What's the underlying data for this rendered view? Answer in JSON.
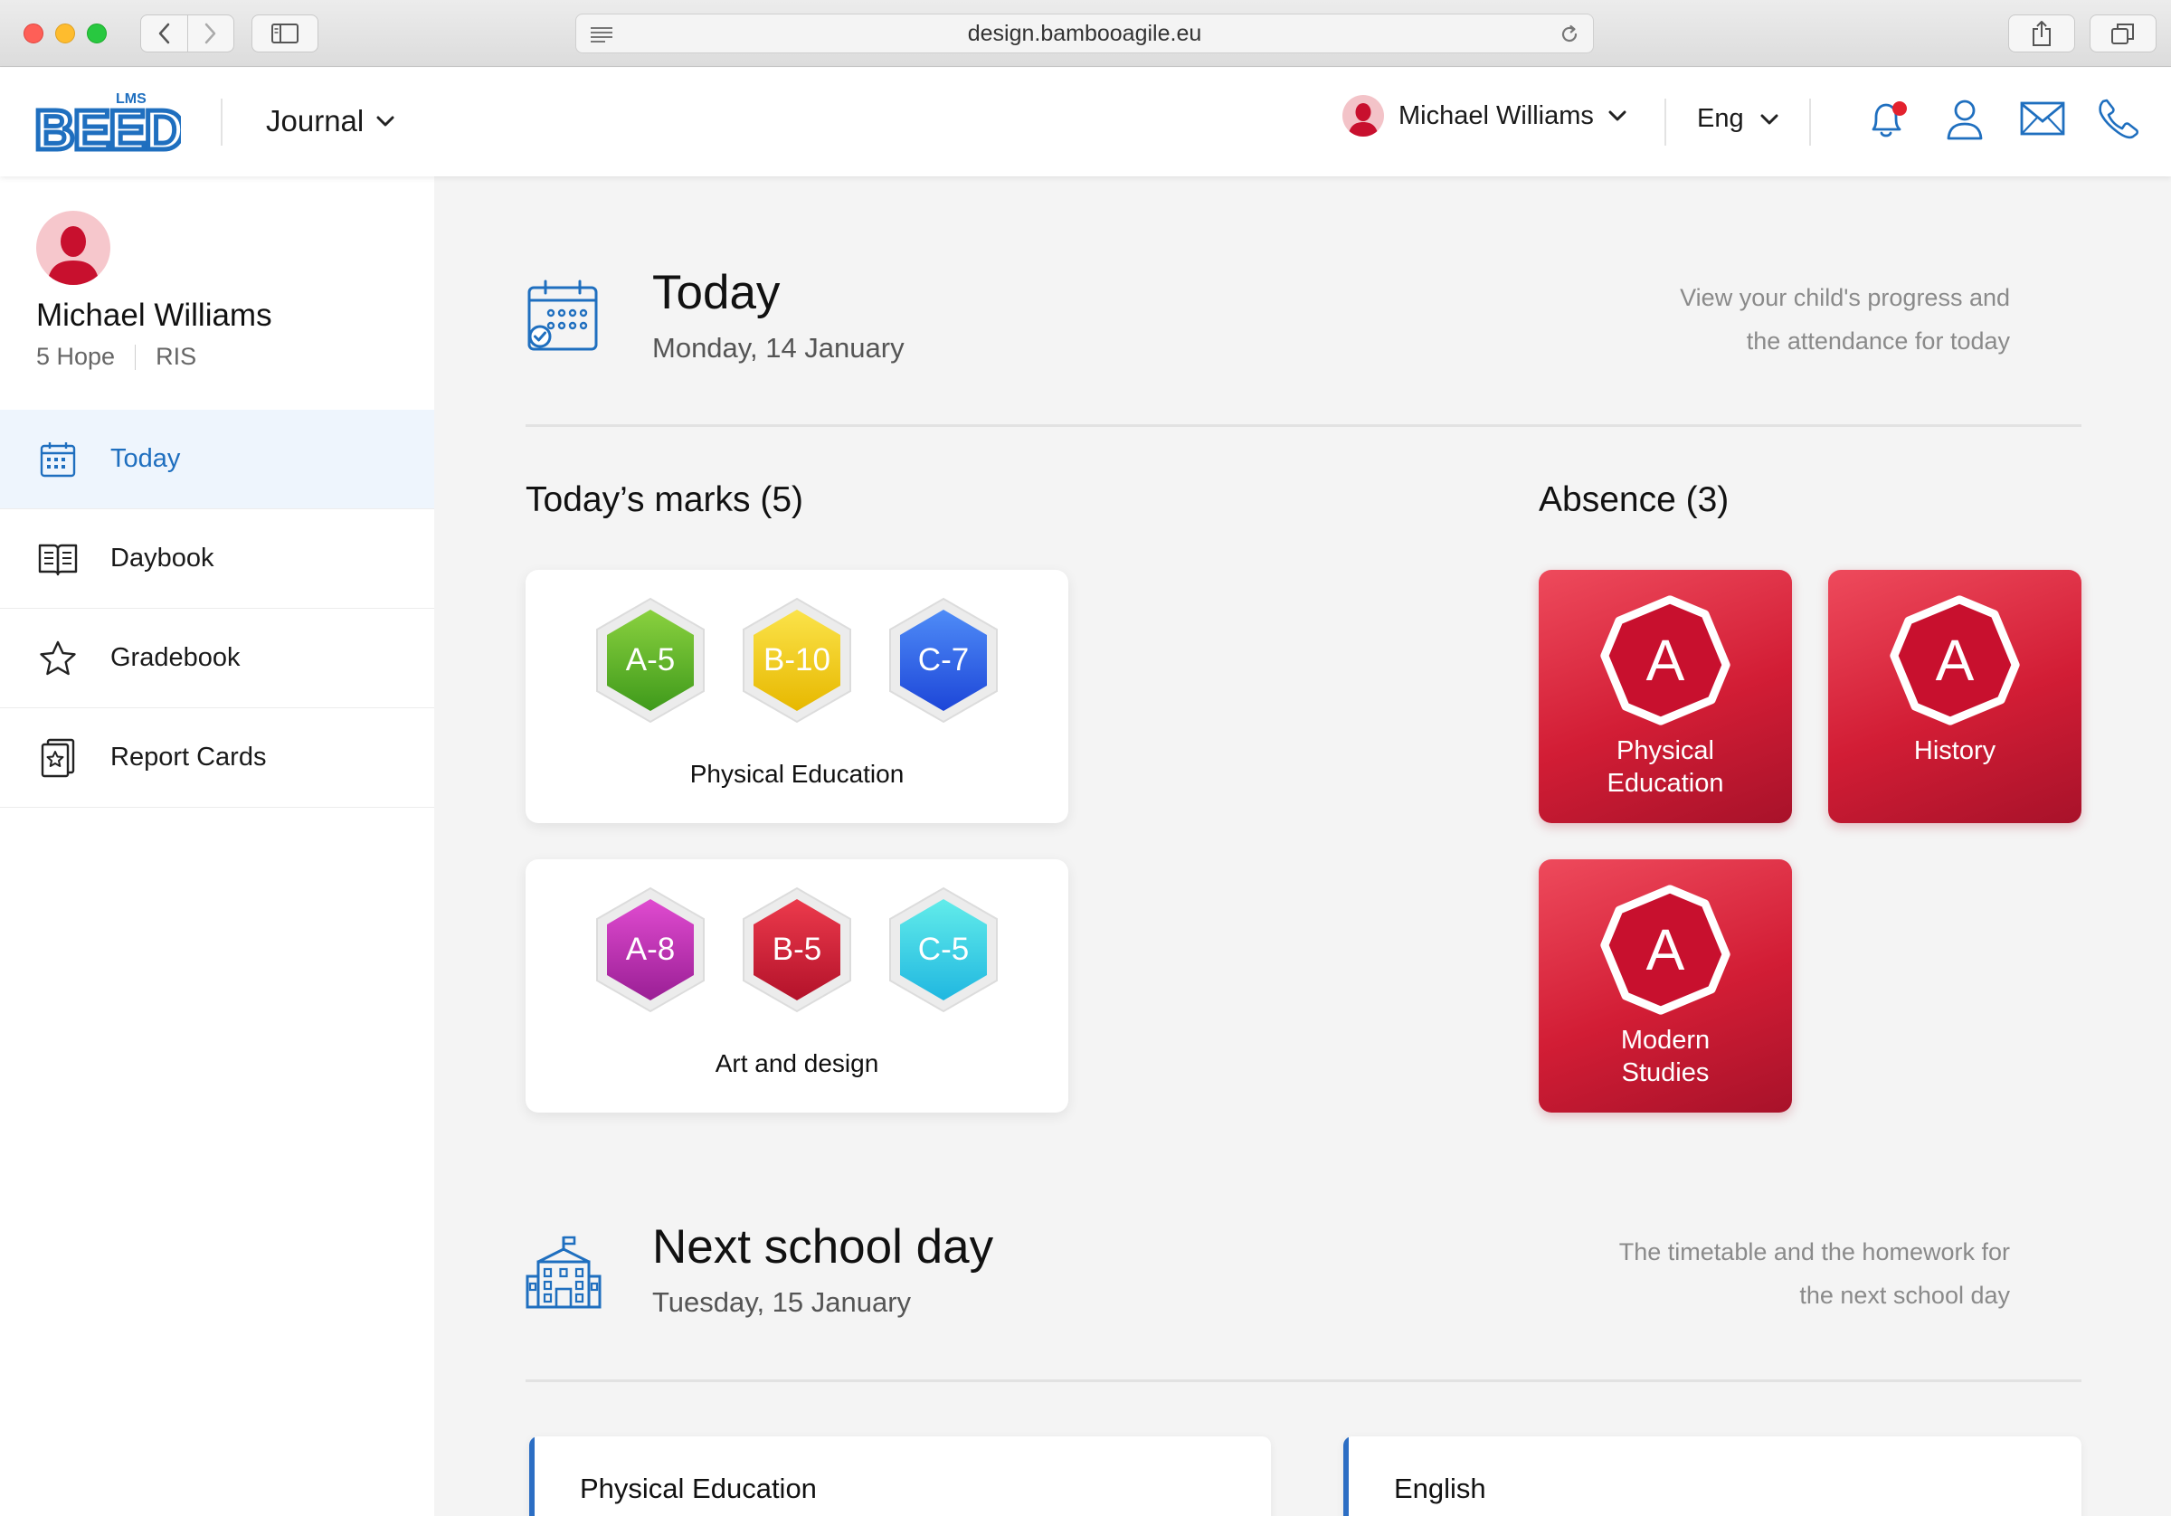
{
  "browser": {
    "url": "design.bambooagile.eu"
  },
  "header": {
    "logo_text": "BEED",
    "logo_badge": "LMS",
    "module_label": "Journal",
    "user_name": "Michael Williams",
    "language": "Eng"
  },
  "sidebar": {
    "profile": {
      "name": "Michael Williams",
      "class_name": "5 Hope",
      "school": "RIS"
    },
    "items": [
      {
        "label": "Today",
        "icon": "calendar-icon",
        "active": true
      },
      {
        "label": "Daybook",
        "icon": "book-open-icon",
        "active": false
      },
      {
        "label": "Gradebook",
        "icon": "star-icon",
        "active": false
      },
      {
        "label": "Report Cards",
        "icon": "report-card-icon",
        "active": false
      }
    ]
  },
  "today": {
    "title": "Today",
    "date": "Monday, 14 January",
    "description_line1": "View your child's progress and",
    "description_line2": "the attendance for today"
  },
  "marks": {
    "title": "Today’s marks (5)",
    "cards": [
      {
        "subject": "Physical Education",
        "marks": [
          {
            "label": "A-5",
            "color_from": "#8ad13f",
            "color_to": "#3f9a1b"
          },
          {
            "label": "B-10",
            "color_from": "#fbe34a",
            "color_to": "#e7b800"
          },
          {
            "label": "C-7",
            "color_from": "#4f8cf7",
            "color_to": "#1d46d8"
          }
        ]
      },
      {
        "subject": "Art and design",
        "marks": [
          {
            "label": "A-8",
            "color_from": "#e04bd0",
            "color_to": "#9a1f95"
          },
          {
            "label": "B-5",
            "color_from": "#ec3a4c",
            "color_to": "#b3122a"
          },
          {
            "label": "C-5",
            "color_from": "#62ecea",
            "color_to": "#20b7e0"
          }
        ]
      }
    ]
  },
  "absence": {
    "title": "Absence (3)",
    "letter": "A",
    "items": [
      {
        "subject_line1": "Physical",
        "subject_line2": "Education"
      },
      {
        "subject_line1": "History",
        "subject_line2": ""
      },
      {
        "subject_line1": "Modern",
        "subject_line2": "Studies"
      }
    ]
  },
  "next_day": {
    "title": "Next school day",
    "date": "Tuesday, 15 January",
    "description_line1": "The timetable and the homework for",
    "description_line2": "the next school day"
  },
  "lessons": [
    {
      "title": "Physical Education"
    },
    {
      "title": "English"
    }
  ],
  "colors": {
    "accent_blue": "#1f6fbf",
    "absence_red": "#d21d35",
    "notification_dot": "#e3222e"
  }
}
